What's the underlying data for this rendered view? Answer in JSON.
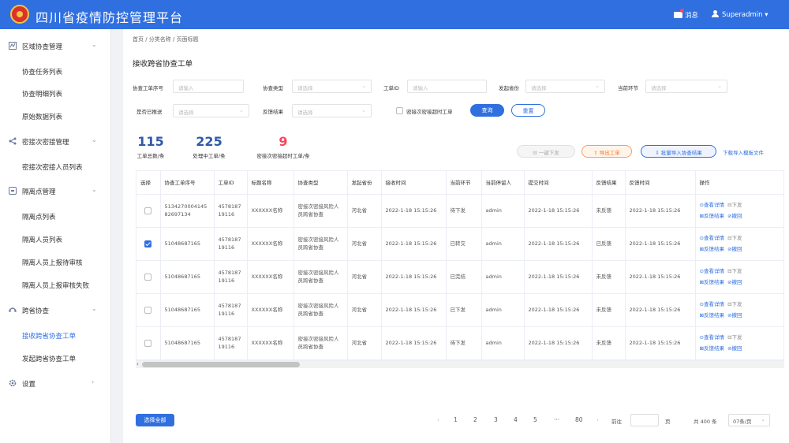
{
  "app": {
    "title": "四川省疫情防控管理平台"
  },
  "header": {
    "messages_label": "消息",
    "user_label": "Superadmin"
  },
  "sidebar": {
    "groups": [
      {
        "label": "区域协查管理",
        "items": [
          "协查任务列表",
          "协查明细列表",
          "原始数据列表"
        ]
      },
      {
        "label": "密接次密接管理",
        "items": [
          "密接次密接人员列表"
        ]
      },
      {
        "label": "隔离点管理",
        "items": [
          "隔离点列表",
          "隔离人员列表",
          "隔离人员上报待审核",
          "隔离人员上报审核失败"
        ]
      },
      {
        "label": "跨省协查",
        "items": [
          "接收跨省协查工单",
          "发起跨省协查工单"
        ]
      },
      {
        "label": "设置",
        "items": []
      }
    ],
    "active_item": "接收跨省协查工单"
  },
  "breadcrumb": "首页 / 分类名称 / 页面标题",
  "page_title": "接收跨省协查工单",
  "filters": {
    "ticket_no": {
      "label": "协查工单序号",
      "placeholder": "请输入"
    },
    "type": {
      "label": "协查类型",
      "placeholder": "请选择"
    },
    "ticket_id": {
      "label": "工单ID",
      "placeholder": "请输入"
    },
    "province": {
      "label": "发起省份",
      "placeholder": "请选择"
    },
    "stage": {
      "label": "当前环节",
      "placeholder": "请选择"
    },
    "pushed": {
      "label": "是否已推送",
      "placeholder": "请选择"
    },
    "feedback": {
      "label": "反馈结果",
      "placeholder": "请选择"
    },
    "overdue_label": "密接次密接超时工单",
    "query_btn": "查询",
    "reset_btn": "重置"
  },
  "stats": [
    {
      "value": "115",
      "label": "工单总数/条",
      "color": "#2f5aa8"
    },
    {
      "value": "225",
      "label": "处理中工单/条",
      "color": "#2f5aa8"
    },
    {
      "value": "9",
      "label": "密接次密接超时工单/条",
      "color": "#f5475b"
    }
  ],
  "actions": {
    "dispatch_all": "一键下发",
    "export": "导出工单",
    "batch_import": "批量导入协查结果",
    "download_template": "下载导入模板文件"
  },
  "table": {
    "headers": [
      "选择",
      "协查工单序号",
      "工单ID",
      "标题名称",
      "协查类型",
      "发起省份",
      "接收时间",
      "当前环节",
      "当前停留人",
      "提交时间",
      "反馈结果",
      "反馈时间",
      "操作"
    ],
    "rows": [
      {
        "checked": false,
        "no": "513427000414582697134",
        "id": "457818719116",
        "title": "XXXXXX名称",
        "type": "密接次密接风险人员跨省协查",
        "province": "河北省",
        "recv": "2022-1-18 15:15:26",
        "stage": "待下发",
        "person": "admin",
        "submit": "2022-1-18 15:15:26",
        "fb": "未反馈",
        "fbtime": "2022-1-18 15:15:26"
      },
      {
        "checked": true,
        "no": "51048687165",
        "id": "457818719116",
        "title": "XXXXXX名称",
        "type": "密接次密接风险人员跨省协查",
        "province": "河北省",
        "recv": "2022-1-18 15:15:26",
        "stage": "已转交",
        "person": "admin",
        "submit": "2022-1-18 15:15:26",
        "fb": "已反馈",
        "fbtime": "2022-1-18 15:15:26"
      },
      {
        "checked": false,
        "no": "51048687165",
        "id": "457818719116",
        "title": "XXXXXX名称",
        "type": "密接次密接风险人员跨省协查",
        "province": "河北省",
        "recv": "2022-1-18 15:15:26",
        "stage": "已完结",
        "person": "admin",
        "submit": "2022-1-18 15:15:26",
        "fb": "未反馈",
        "fbtime": "2022-1-18 15:15:26"
      },
      {
        "checked": false,
        "no": "51048687165",
        "id": "457818719116",
        "title": "XXXXXX名称",
        "type": "密接次密接风险人员跨省协查",
        "province": "河北省",
        "recv": "2022-1-18 15:15:26",
        "stage": "已下发",
        "person": "admin",
        "submit": "2022-1-18 15:15:26",
        "fb": "未反馈",
        "fbtime": "2022-1-18 15:15:26"
      },
      {
        "checked": false,
        "no": "51048687165",
        "id": "457818719116",
        "title": "XXXXXX名称",
        "type": "密接次密接风险人员跨省协查",
        "province": "河北省",
        "recv": "2022-1-18 15:15:26",
        "stage": "待下发",
        "person": "admin",
        "submit": "2022-1-18 15:15:26",
        "fb": "未反馈",
        "fbtime": "2022-1-18 15:15:26"
      }
    ],
    "ops": {
      "view": "查看详情",
      "dispatch": "下发",
      "feedback": "反馈结果",
      "revoke": "撤回"
    }
  },
  "footer": {
    "select_all": "选择全部",
    "pages": [
      "1",
      "2",
      "3",
      "4",
      "5",
      "···",
      "80"
    ],
    "prev": "‹",
    "next": "›",
    "goto_label": "前往",
    "page_suffix": "页",
    "total": "共 400 条",
    "page_size": "07条/页"
  }
}
